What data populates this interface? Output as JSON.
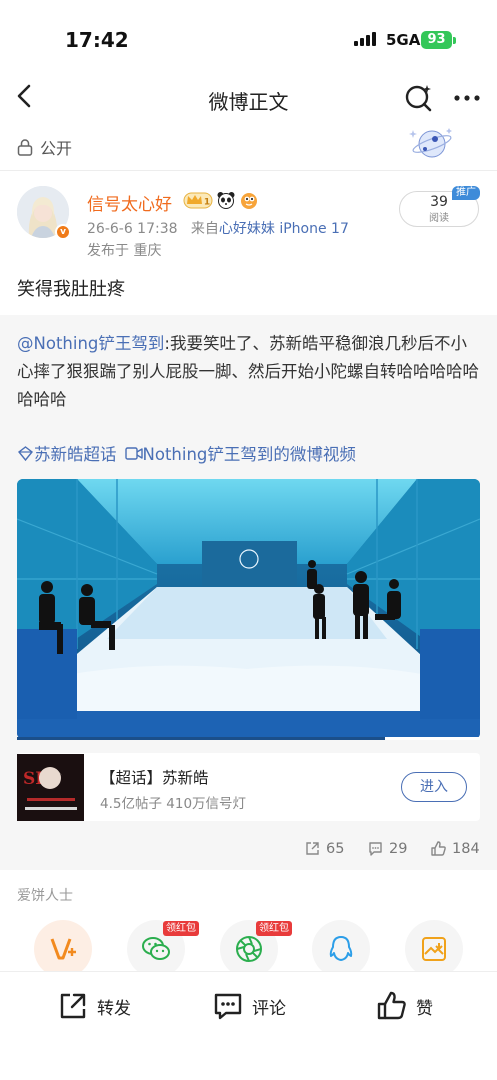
{
  "status": {
    "time": "17:42",
    "network": "5GA",
    "battery": "93"
  },
  "nav": {
    "title": "微博正文"
  },
  "visibility": "公开",
  "post": {
    "username": "信号太心好",
    "time": "26-6-6 17:38",
    "source_prefix": "来自",
    "source": "心好妹妹 iPhone 17",
    "location": "发布于 重庆",
    "reads": "39",
    "reads_label": "阅读",
    "promo_tag": "推广",
    "text": "笑得我肚肚疼"
  },
  "repost": {
    "mention": "@Nothing铲王驾到",
    "text": ":我要笑吐了、苏新皓平稳御浪几秒后不小心摔了狠狠踹了别人屁股一脚、然后开始小陀螺自转哈哈哈哈哈哈哈哈",
    "topic": "苏新皓超话",
    "video_link": "Nothing铲王驾到的微博视频",
    "card": {
      "title": "【超话】苏新皓",
      "subtitle": "4.5亿帖子 410万信号灯",
      "button": "进入"
    },
    "stats": {
      "reposts": "65",
      "comments": "29",
      "likes": "184"
    }
  },
  "share": {
    "label": "爱饼人士",
    "redpack_label": "领红包",
    "items": [
      "weibo-fans",
      "wechat",
      "moments",
      "qq",
      "save-image"
    ]
  },
  "bottom": {
    "repost": "转发",
    "comment": "评论",
    "like": "赞"
  },
  "colors": {
    "accent": "#f06b1e",
    "link": "#4a6fb5",
    "battery": "#34c759"
  }
}
